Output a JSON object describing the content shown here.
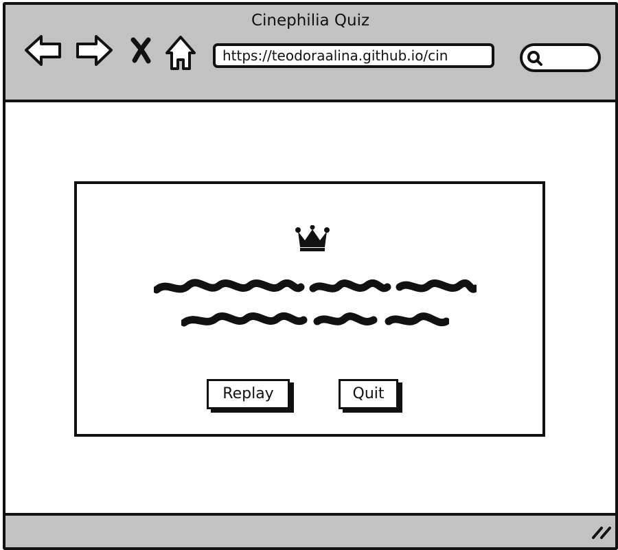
{
  "window": {
    "title": "Cinephilia Quiz"
  },
  "toolbar": {
    "back_icon": "back-arrow-icon",
    "forward_icon": "forward-arrow-icon",
    "stop_icon": "close-icon",
    "home_icon": "home-icon",
    "url": "https://teodoraalina.github.io/cin",
    "search_value": "",
    "search_icon": "search-icon"
  },
  "dialog": {
    "icon": "crown-icon",
    "replay_label": "Replay",
    "quit_label": "Quit"
  },
  "statusbar": {
    "resize_icon": "resize-grip-icon"
  },
  "colors": {
    "chrome": "#c2c2c2",
    "ink": "#111111",
    "background": "#ffffff"
  }
}
